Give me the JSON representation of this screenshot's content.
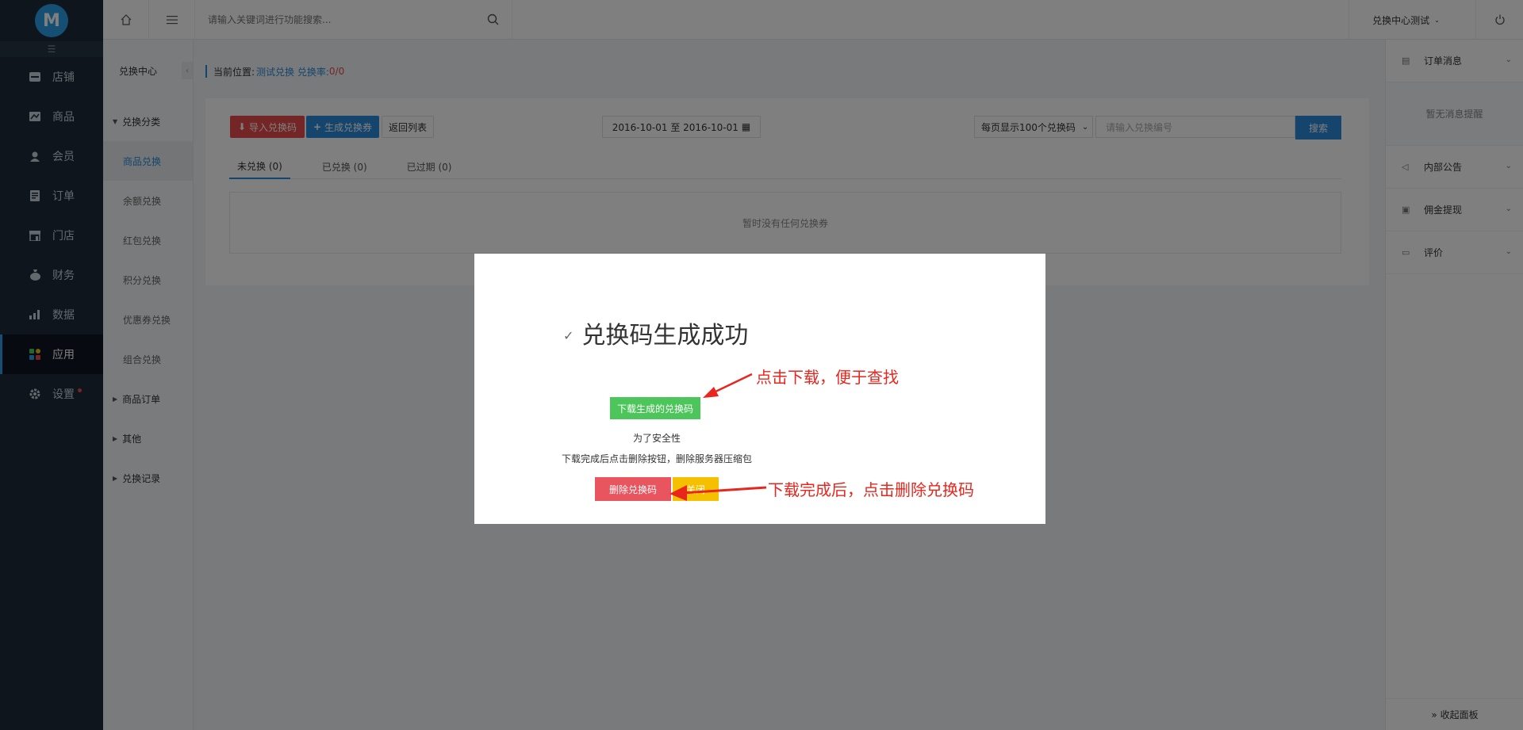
{
  "brand": {
    "logo_letter": "M"
  },
  "left_nav": {
    "collapse_glyph": "☰",
    "items": [
      {
        "label": "店铺",
        "icon": "store-icon"
      },
      {
        "label": "商品",
        "icon": "goods-icon"
      },
      {
        "label": "会员",
        "icon": "member-icon"
      },
      {
        "label": "订单",
        "icon": "order-icon"
      },
      {
        "label": "门店",
        "icon": "shop-icon"
      },
      {
        "label": "财务",
        "icon": "finance-icon"
      },
      {
        "label": "数据",
        "icon": "data-icon"
      },
      {
        "label": "应用",
        "icon": "app-icon",
        "active": true
      },
      {
        "label": "设置",
        "icon": "gear-icon",
        "badge": true
      }
    ]
  },
  "sub_nav": {
    "title": "兑换中心",
    "group1": "兑换分类",
    "items": [
      "商品兑换",
      "余额兑换",
      "红包兑换",
      "积分兑换",
      "优惠券兑换",
      "组合兑换"
    ],
    "group2": "商品订单",
    "group3": "其他",
    "group4": "兑换记录"
  },
  "topbar": {
    "search_placeholder": "请输入关键词进行功能搜索...",
    "user": "兑换中心测试"
  },
  "breadcrumb": {
    "prefix": "当前位置:",
    "link": "测试兑换 兑换率:",
    "rate": "0/0"
  },
  "toolbar": {
    "import_label": "导入兑换码",
    "generate_label": "生成兑换券",
    "back_label": "返回列表",
    "date_range": "2016-10-01 至 2016-10-01",
    "per_page": "每页显示100个兑换码",
    "code_placeholder": "请输入兑换编号",
    "search_label": "搜索"
  },
  "tabs": [
    {
      "label": "未兑换 (0)",
      "active": true
    },
    {
      "label": "已兑换 (0)"
    },
    {
      "label": "已过期 (0)"
    }
  ],
  "empty_text": "暂时没有任何兑换券",
  "right_panel": {
    "order_msg": "订单消息",
    "no_msg": "暂无消息提醒",
    "notice": "内部公告",
    "commission": "佣金提现",
    "review": "评价",
    "collapse": "» 收起面板"
  },
  "modal": {
    "title": "兑换码生成成功",
    "download_label": "下载生成的兑换码",
    "safety_line1": "为了安全性",
    "safety_line2": "下载完成后点击删除按钮，删除服务器压缩包",
    "delete_label": "删除兑换码",
    "close_label": "关闭"
  },
  "annotations": {
    "download_hint": "点击下载，便于查找",
    "delete_hint": "下载完成后，点击删除兑换码"
  },
  "colors": {
    "accent": "#2a8bd8",
    "danger": "#e84a4a",
    "success": "#4cc65b",
    "warning": "#f5c000",
    "annotation": "#e8261e"
  }
}
